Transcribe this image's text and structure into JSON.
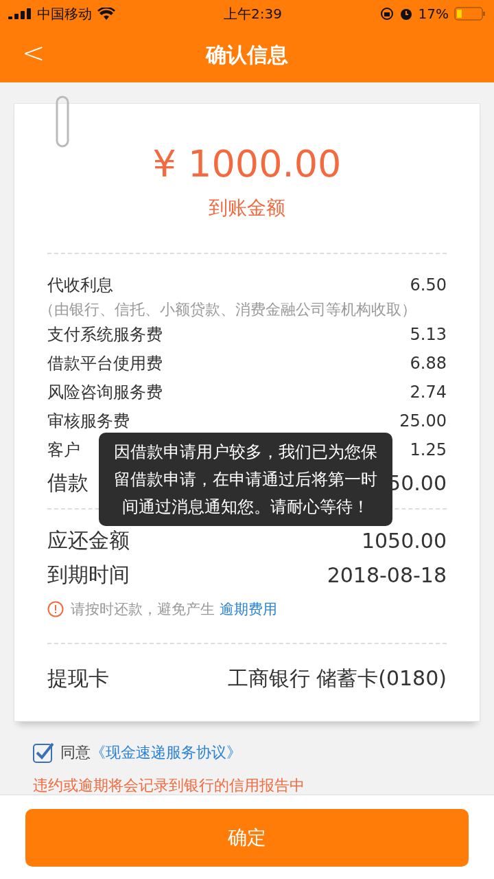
{
  "status_bar": {
    "carrier": "中国移动",
    "time": "上午2:39",
    "battery": "17%"
  },
  "nav": {
    "back": "<",
    "title": "确认信息"
  },
  "amount": {
    "value": "¥ 1000.00",
    "label": "到账金额"
  },
  "fees": [
    {
      "label": "代收利息",
      "value": "6.50",
      "note": "（由银行、信托、小额贷款、消费金融公司等机构收取）"
    },
    {
      "label": "支付系统服务费",
      "value": "5.13"
    },
    {
      "label": "借款平台使用费",
      "value": "6.88"
    },
    {
      "label": "风险咨询服务费",
      "value": "2.74"
    },
    {
      "label": "审核服务费",
      "value": "25.00"
    },
    {
      "label": "客户",
      "value": "1.25"
    }
  ],
  "total": {
    "label": "借款",
    "value": "50.00"
  },
  "summary": [
    {
      "label": "应还金额",
      "value": "1050.00"
    },
    {
      "label": "到期时间",
      "value": "2018-08-18"
    }
  ],
  "warning": {
    "text": "请按时还款，避免产生",
    "link": "逾期费用"
  },
  "card": {
    "label": "提现卡",
    "value": "工商银行 储蓄卡(0180)"
  },
  "agreement": {
    "checked": true,
    "text": "同意",
    "link": "《现金速递服务协议》"
  },
  "disclaimer": "违约或逾期将会记录到银行的信用报告中",
  "toast": "因借款申请用户较多，我们已为您保留借款申请，在申请通过后将第一时间通过消息通知您。请耐心等待！",
  "confirm_button": "确定"
}
